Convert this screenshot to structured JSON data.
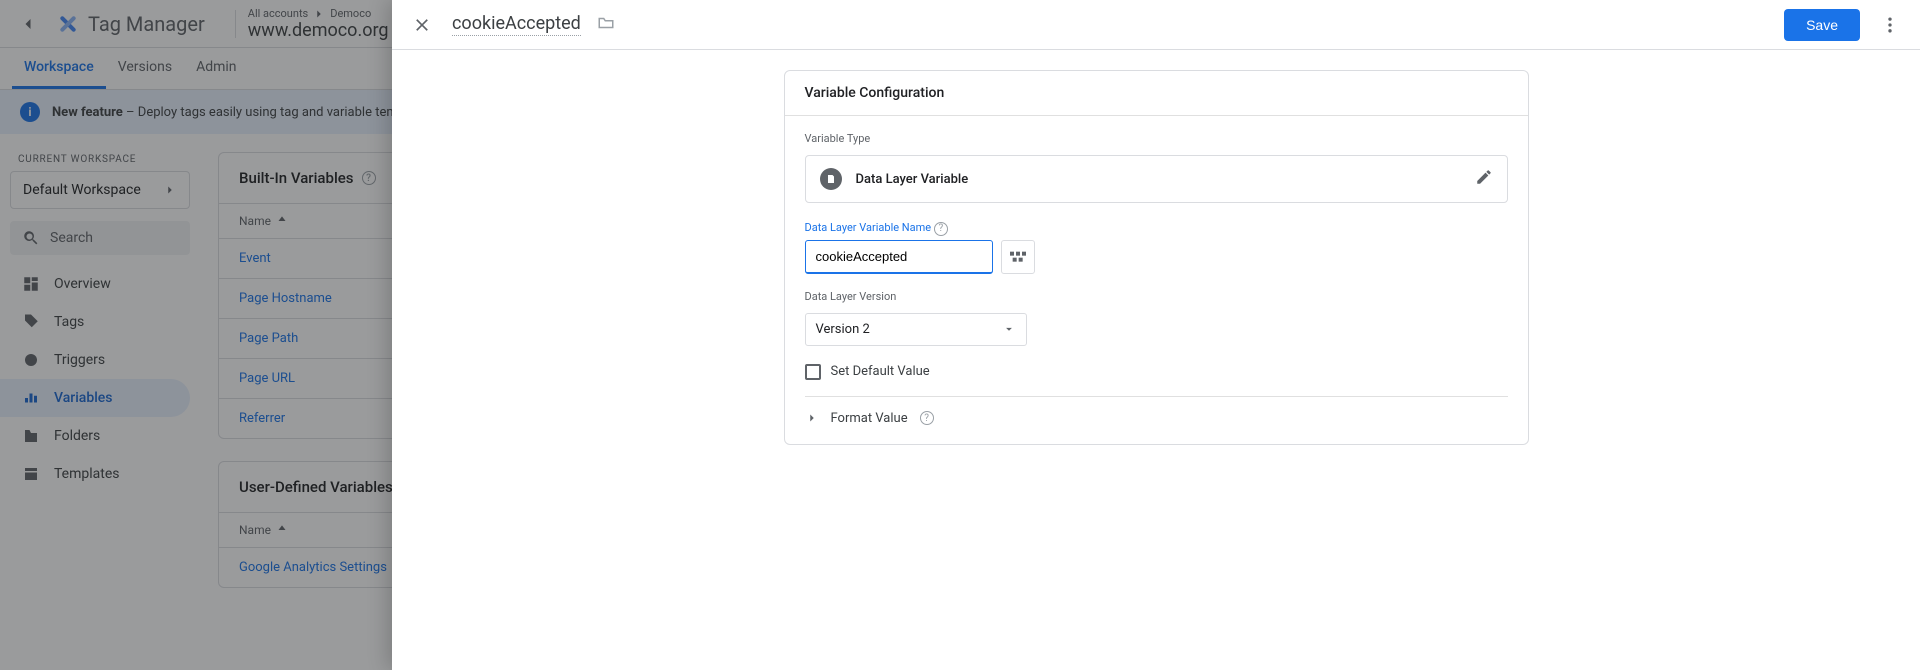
{
  "app": {
    "product": "Tag Manager",
    "breadcrumb_parent": "All accounts",
    "breadcrumb_child": "Democo",
    "container": "www.democo.org"
  },
  "tabs": {
    "workspace": "Workspace",
    "versions": "Versions",
    "admin": "Admin"
  },
  "banner": {
    "title": "New feature",
    "sep": "–",
    "text": "Deploy tags easily using tag and variable templates from the Community Template Gallery."
  },
  "sidebar": {
    "label": "CURRENT WORKSPACE",
    "workspace": "Default Workspace",
    "search": "Search",
    "items": [
      {
        "label": "Overview"
      },
      {
        "label": "Tags"
      },
      {
        "label": "Triggers"
      },
      {
        "label": "Variables"
      },
      {
        "label": "Folders"
      },
      {
        "label": "Templates"
      }
    ]
  },
  "tables": {
    "builtin_title": "Built-In Variables",
    "user_title": "User-Defined Variables",
    "col": "Name",
    "builtin_rows": [
      "Event",
      "Page Hostname",
      "Page Path",
      "Page URL",
      "Referrer"
    ],
    "user_rows": [
      "Google Analytics Settings"
    ]
  },
  "panel": {
    "title": "cookieAccepted",
    "save": "Save",
    "config_title": "Variable Configuration",
    "vtype_label": "Variable Type",
    "vtype_name": "Data Layer Variable",
    "dlname_label": "Data Layer Variable Name",
    "dlname_value": "cookieAccepted",
    "dlver_label": "Data Layer Version",
    "dlver_value": "Version 2",
    "setdefault": "Set Default Value",
    "format": "Format Value"
  }
}
